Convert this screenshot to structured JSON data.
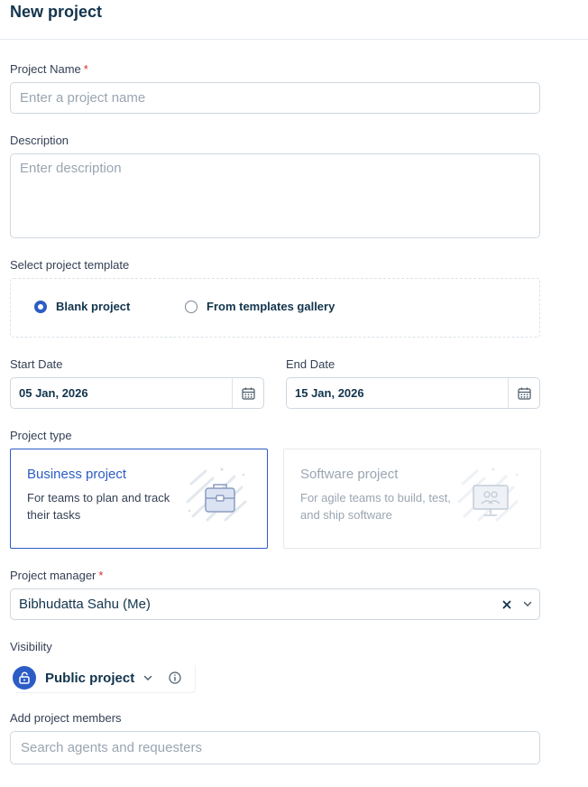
{
  "header": {
    "title": "New project"
  },
  "form": {
    "project_name": {
      "label": "Project Name",
      "required_mark": "*",
      "placeholder": "Enter a project name",
      "value": ""
    },
    "description": {
      "label": "Description",
      "placeholder": "Enter description",
      "value": ""
    },
    "template": {
      "label": "Select project template",
      "options": [
        {
          "label": "Blank project",
          "selected": true
        },
        {
          "label": "From templates gallery",
          "selected": false
        }
      ]
    },
    "start_date": {
      "label": "Start Date",
      "value": "05 Jan, 2026",
      "icon": "calendar-icon"
    },
    "end_date": {
      "label": "End Date",
      "value": "15 Jan, 2026",
      "icon": "calendar-icon"
    },
    "project_type": {
      "label": "Project type",
      "options": [
        {
          "title": "Business project",
          "description": "For teams to plan and track their tasks",
          "selected": true,
          "icon": "briefcase-icon"
        },
        {
          "title": "Software project",
          "description": "For agile teams to build, test, and ship software",
          "selected": false,
          "icon": "monitor-users-icon"
        }
      ]
    },
    "project_manager": {
      "label": "Project manager",
      "required_mark": "*",
      "value": "Bibhudatta Sahu (Me)",
      "clear_icon": "close-icon",
      "dropdown_icon": "chevron-down-icon"
    },
    "visibility": {
      "label": "Visibility",
      "value": "Public project",
      "icon": "unlock-icon",
      "info_icon": "info-icon"
    },
    "members": {
      "label": "Add project members",
      "placeholder": "Search agents and requesters",
      "value": ""
    }
  },
  "colors": {
    "accent": "#2c5cc5",
    "required": "#d72d30",
    "border": "#cfd7df",
    "title": "#12344d"
  }
}
